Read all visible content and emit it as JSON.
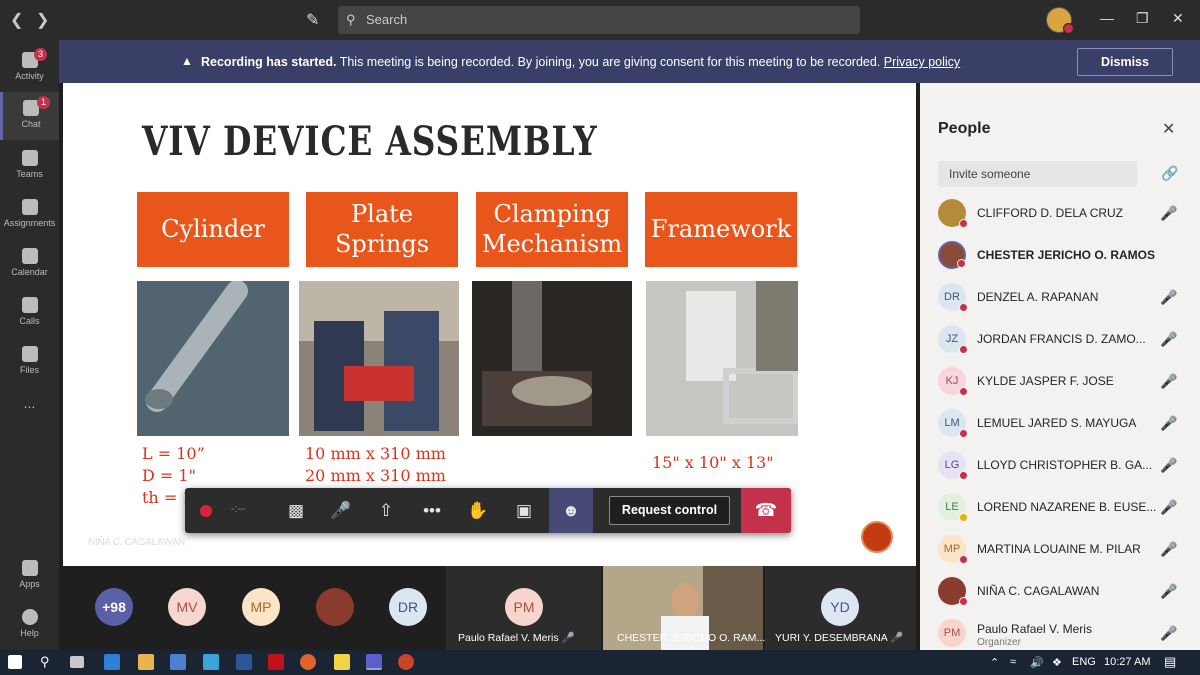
{
  "topbar": {
    "search_placeholder": "Search",
    "back_icon": "chevron-left-icon",
    "forward_icon": "chevron-right-icon"
  },
  "rail": {
    "items": [
      {
        "label": "Activity",
        "badge": "3"
      },
      {
        "label": "Chat",
        "badge": "1"
      },
      {
        "label": "Teams",
        "badge": ""
      },
      {
        "label": "Assignments",
        "badge": ""
      },
      {
        "label": "Calendar",
        "badge": ""
      },
      {
        "label": "Calls",
        "badge": ""
      },
      {
        "label": "Files",
        "badge": ""
      }
    ],
    "more": "...",
    "apps": "Apps",
    "help": "Help"
  },
  "banner": {
    "bold": "Recording has started.",
    "text": " This meeting is being recorded. By joining, you are giving consent for this meeting to be recorded. ",
    "link": "Privacy policy",
    "dismiss": "Dismiss"
  },
  "slide": {
    "title": "VIV DEVICE ASSEMBLY",
    "boxes": [
      {
        "line1": "Cylinder",
        "line2": ""
      },
      {
        "line1": "Plate",
        "line2": "Springs"
      },
      {
        "line1": "Clamping",
        "line2": "Mechanism"
      },
      {
        "line1": "Framework",
        "line2": ""
      }
    ],
    "specs_cylinder": [
      "L = 10”",
      "D = 1\"",
      "th = 1/16 inch"
    ],
    "specs_springs": [
      "10 mm x 310 mm",
      "20 mm x 310 mm"
    ],
    "specs_framework": "15\" x 10\" x 13\""
  },
  "controls": {
    "timer": "-:--",
    "request_control": "Request control"
  },
  "presenter_label": "NIÑA C. CAGALAWAN",
  "strip": {
    "overflow": "+98",
    "avatars": [
      "MV",
      "MP",
      "DR"
    ],
    "tile1_initials": "PM",
    "tile1_name": "Paulo Rafael V. Meris",
    "tile2_name": "CHESTER JERICHO O. RAM...",
    "tile3_initials": "YD",
    "tile3_name": "YURI Y. DESEMBRANA"
  },
  "people": {
    "title": "People",
    "invite_placeholder": "Invite someone",
    "list": [
      {
        "initials": "",
        "name": "CLIFFORD D. DELA CRUZ",
        "bold": false
      },
      {
        "initials": "",
        "name": "CHESTER JERICHO O. RAMOS",
        "bold": true
      },
      {
        "initials": "DR",
        "name": "DENZEL A. RAPANAN",
        "bold": false
      },
      {
        "initials": "JZ",
        "name": "JORDAN FRANCIS D. ZAMO...",
        "bold": false
      },
      {
        "initials": "KJ",
        "name": "KYLDE JASPER F. JOSE",
        "bold": false
      },
      {
        "initials": "LM",
        "name": "LEMUEL JARED S. MAYUGA",
        "bold": false
      },
      {
        "initials": "LG",
        "name": "LLOYD CHRISTOPHER B. GA...",
        "bold": false
      },
      {
        "initials": "LE",
        "name": "LOREND NAZARENE B. EUSE...",
        "bold": false
      },
      {
        "initials": "MP",
        "name": "MARTINA LOUAINE M. PILAR",
        "bold": false
      },
      {
        "initials": "",
        "name": "NIÑA C. CAGALAWAN",
        "bold": false
      },
      {
        "initials": "PM",
        "name": "Paulo Rafael V. Meris",
        "bold": false,
        "sub": "Organizer"
      }
    ]
  },
  "taskbar": {
    "lang": "ENG",
    "time": "10:27 AM"
  },
  "colors": {
    "accent": "#6264a7",
    "banner": "#3a3f68",
    "slide_orange": "#e8561b",
    "spec_red": "#d9341c",
    "hangup": "#c4314b"
  }
}
